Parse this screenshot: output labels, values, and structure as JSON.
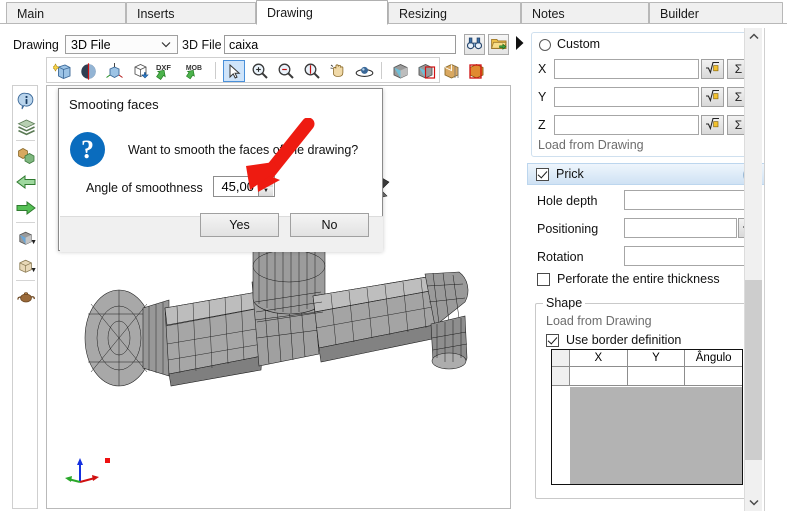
{
  "tabs": [
    {
      "label": "Main",
      "active": false
    },
    {
      "label": "Inserts",
      "active": false
    },
    {
      "label": "Drawing",
      "active": true
    },
    {
      "label": "Resizing",
      "active": false
    },
    {
      "label": "Notes",
      "active": false
    },
    {
      "label": "Builder",
      "active": false
    }
  ],
  "toprow": {
    "drawing_label": "Drawing",
    "drawing_value": "3D File",
    "file_label": "3D File",
    "file_value": "caixa",
    "find_icon": "binoculars-icon",
    "open_icon": "open-folder-icon",
    "expand_icon": "play-arrow-icon"
  },
  "icon_toolbar": {
    "items": [
      {
        "name": "new-3d-object-icon",
        "title": "New 3D object"
      },
      {
        "name": "sphere-half-icon",
        "title": "Sphere"
      },
      {
        "name": "axis-cube-icon",
        "title": "Axis cube"
      },
      {
        "name": "cube-import-icon",
        "title": "Import cube"
      },
      {
        "name": "dxf-export-icon",
        "title": "DXF",
        "text": "DXF"
      },
      {
        "name": "mob-export-icon",
        "title": "MOB",
        "text": "MOB"
      },
      {
        "name": "select-arrow-icon",
        "title": "Select",
        "selected": true
      },
      {
        "name": "zoom-in-icon",
        "title": "Zoom in"
      },
      {
        "name": "zoom-out-icon",
        "title": "Zoom out"
      },
      {
        "name": "zoom-fit-icon",
        "title": "Zoom fit"
      },
      {
        "name": "pan-hand-icon",
        "title": "Pan"
      },
      {
        "name": "orbit-rotate-icon",
        "title": "Orbit"
      },
      {
        "name": "view-solid-icon",
        "title": "Solid view"
      },
      {
        "name": "view-solid-edges-icon",
        "title": "Solid with edges"
      },
      {
        "name": "view-wireframe-icon",
        "title": "Wireframe"
      },
      {
        "name": "view-shaded-icon",
        "title": "Shaded"
      }
    ]
  },
  "left_toolbar": {
    "items": [
      {
        "name": "info-icon",
        "title": "Info"
      },
      {
        "name": "layers-icon",
        "title": "Layers"
      },
      {
        "name": "blocks-icon",
        "title": "Blocks"
      },
      {
        "name": "arrow-left-icon",
        "title": "Previous"
      },
      {
        "name": "arrow-right-icon",
        "title": "Next"
      },
      {
        "name": "cube-view-icon",
        "title": "View",
        "dropdown": true
      },
      {
        "name": "box-icon",
        "title": "Box",
        "dropdown": true
      },
      {
        "name": "teapot-icon",
        "title": "Teapot"
      }
    ]
  },
  "viewport": {
    "model_name": "faucet-wireframe-model",
    "axis_gizmo": "xyz-axis-gizmo",
    "origin_marker": "origin-marker"
  },
  "right_panel": {
    "custom": {
      "radio_label": "Custom",
      "selected": false,
      "fields": [
        {
          "label": "X",
          "value": "",
          "sqrt_btn": "sqrt-icon",
          "sum_btn": "sigma-icon"
        },
        {
          "label": "Y",
          "value": "",
          "sqrt_btn": "sqrt-icon",
          "sum_btn": "sigma-icon"
        },
        {
          "label": "Z",
          "value": "",
          "sqrt_btn": "sqrt-icon",
          "sum_btn": "sigma-icon"
        }
      ],
      "note": "Load from Drawing"
    },
    "prick": {
      "title": "Prick",
      "checked": true,
      "collapse_icon": "chevron-up-double-icon",
      "hole_depth_label": "Hole depth",
      "hole_depth_value": "",
      "positioning_label": "Positioning",
      "positioning_value": "",
      "positioning_btn": "sqrt-icon",
      "rotation_label": "Rotation",
      "rotation_value": "",
      "perforate_label": "Perforate the entire thickness",
      "perforate_checked": false,
      "shape": {
        "title": "Shape",
        "note": "Load from Drawing",
        "border_def_label": "Use border definition",
        "border_def_checked": true,
        "grid": {
          "columns": [
            "X",
            "Y",
            "Ângulo"
          ],
          "rows": [
            [
              "",
              "",
              ""
            ]
          ]
        }
      }
    },
    "scrollbar": {
      "up_icon": "chevron-up-icon",
      "down_icon": "chevron-down-icon"
    }
  },
  "dialog": {
    "title": "Smooting faces",
    "icon": "question-mark-icon",
    "message": "Want to smooth the faces of the drawing?",
    "field_label": "Angle of smoothness",
    "field_value": "45,00",
    "spinner_up": "spinner-up-icon",
    "spinner_down": "spinner-down-icon",
    "yes_label": "Yes",
    "no_label": "No"
  },
  "annotation": {
    "name": "red-arrow-annotation",
    "color": "#ee1b11"
  },
  "colors": {
    "accent": "#0a6cbe",
    "panel_header": "#cfe2f4",
    "selection": "#cfe4fa",
    "grid_fill": "#b3b3b3"
  }
}
